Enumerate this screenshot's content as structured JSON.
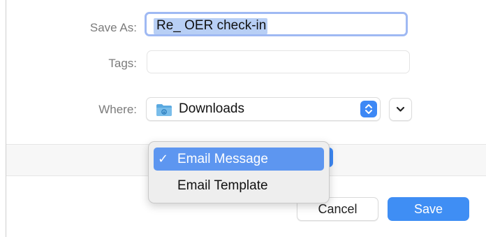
{
  "dialog": {
    "save_as_label": "Save As:",
    "save_as_value": "Re_ OER check-in",
    "tags_label": "Tags:",
    "tags_value": "",
    "where_label": "Where:",
    "where_value": "Downloads",
    "where_icon": "folder-icon",
    "cancel_label": "Cancel",
    "save_label": "Save",
    "accent_color": "#3f8ef4"
  },
  "format_menu": {
    "options": [
      {
        "label": "Email Message",
        "checked": true,
        "check_mark": "✓"
      },
      {
        "label": "Email Template",
        "checked": false
      }
    ]
  }
}
